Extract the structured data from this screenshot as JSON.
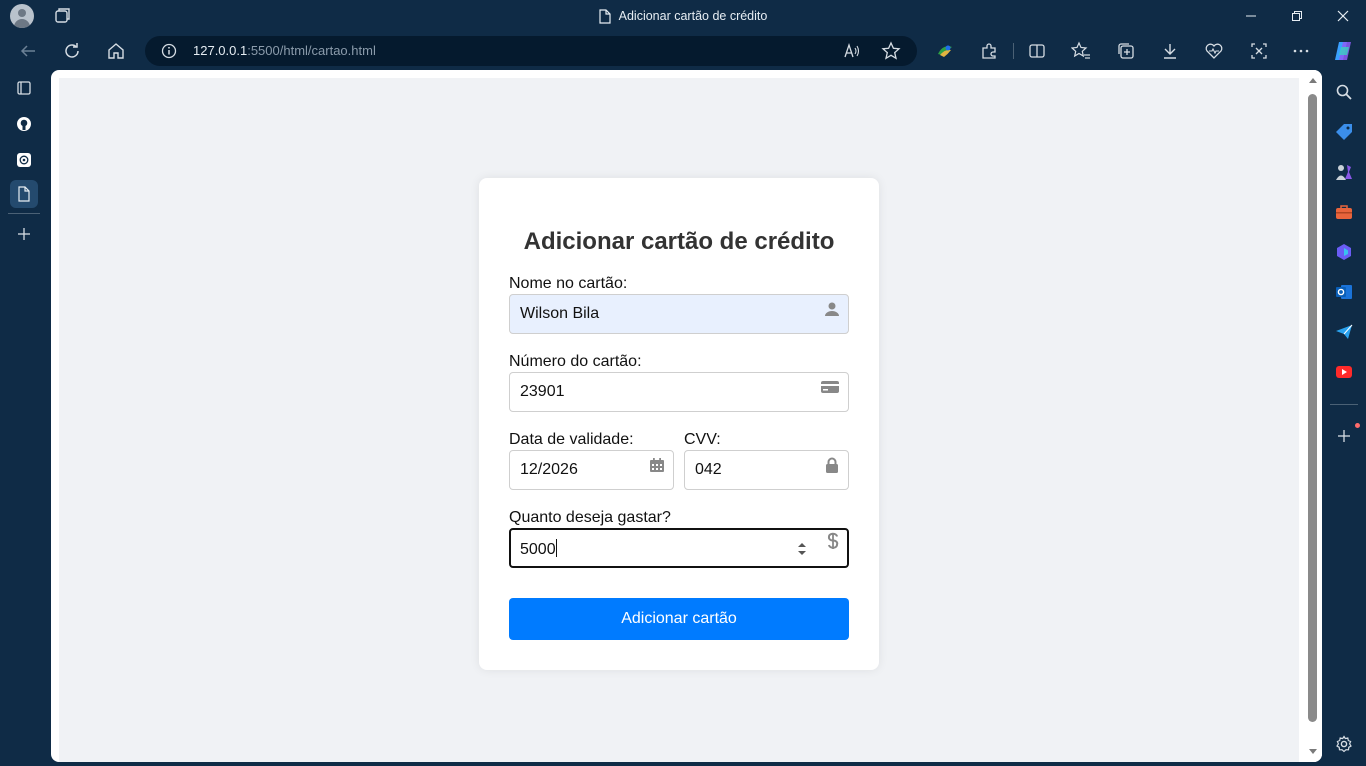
{
  "window": {
    "title": "Adicionar cartão de crédito"
  },
  "address_bar": {
    "url_host": "127.0.0.1",
    "url_rest": ":5500/html/cartao.html"
  },
  "form": {
    "heading": "Adicionar cartão de crédito",
    "name_label": "Nome no cartão:",
    "name_value": "Wilson Bila",
    "number_label": "Número do cartão:",
    "number_value": "23901",
    "expiry_label": "Data de validade:",
    "expiry_value": "12/2026",
    "cvv_label": "CVV:",
    "cvv_value": "042",
    "amount_label": "Quanto deseja gastar?",
    "amount_value": "5000",
    "submit_label": "Adicionar cartão"
  },
  "colors": {
    "browser_frame": "#0f2b46",
    "page_background": "#f0f2f5",
    "primary_button": "#007bff",
    "autofill_background": "#e8f0fe"
  },
  "icons": {
    "name_field": "user-icon",
    "number_field": "credit-card-icon",
    "expiry_field": "calendar-icon",
    "cvv_field": "lock-icon",
    "amount_field": "dollar-icon"
  }
}
